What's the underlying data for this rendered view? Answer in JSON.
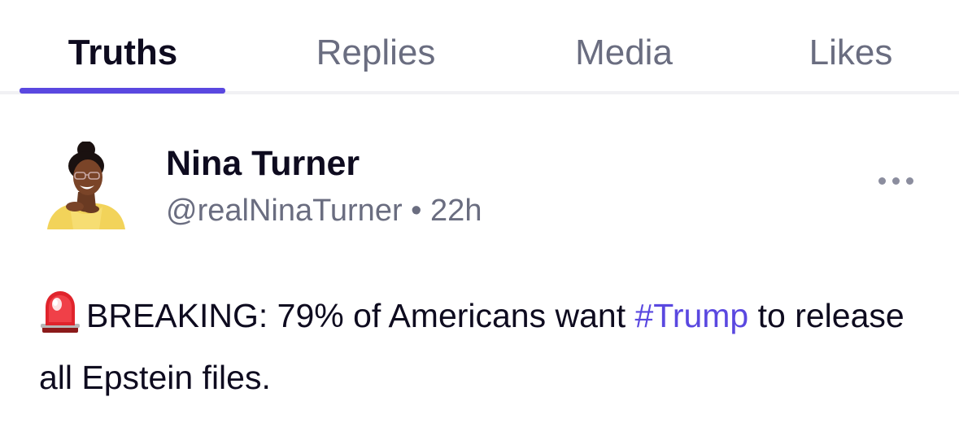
{
  "tabs": {
    "truths": "Truths",
    "replies": "Replies",
    "media": "Media",
    "likes": "Likes",
    "active": "Truths"
  },
  "post": {
    "author_name": "Nina Turner",
    "handle": "@realNinaTurner",
    "separator": "•",
    "time": "22h",
    "text_before": "BREAKING: 79% of Americans want ",
    "hashtag": "#Trump",
    "text_after": " to release all Epstein files.",
    "siren_icon": "siren-emoji-icon",
    "more_icon": "more-options-icon"
  },
  "colors": {
    "accent": "#5a48e0",
    "text_primary": "#0e0b1f",
    "text_secondary": "#6a6d80"
  }
}
